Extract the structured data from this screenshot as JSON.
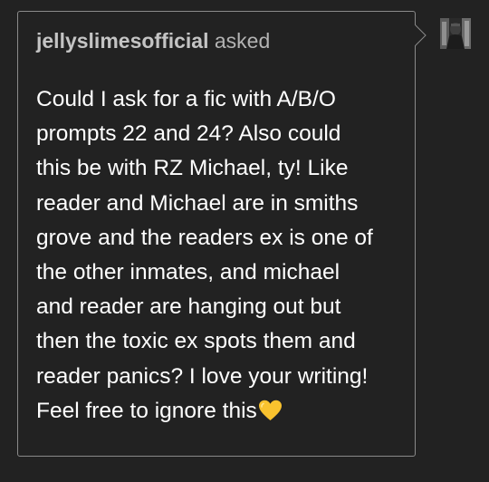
{
  "ask": {
    "asker_name": "jellyslimesofficial",
    "asked_label": "asked",
    "lines": [
      "Could I ask for a fic with A/B/O",
      "prompts 22 and 24? Also could",
      "this be with RZ Michael, ty! Like",
      "reader and Michael are in smiths",
      "grove and the readers ex is one of",
      "the other inmates, and michael",
      "and reader are hanging out but",
      "then the toxic ex spots them and",
      "reader panics? I love your writing!",
      "Feel free to ignore this"
    ],
    "end_emoji": "yellow-heart-icon"
  },
  "colors": {
    "background": "#222222",
    "border": "#8a8a8a",
    "text": "#ffffff",
    "asker": "#c4c4c4",
    "heart": "#f9c22e"
  }
}
